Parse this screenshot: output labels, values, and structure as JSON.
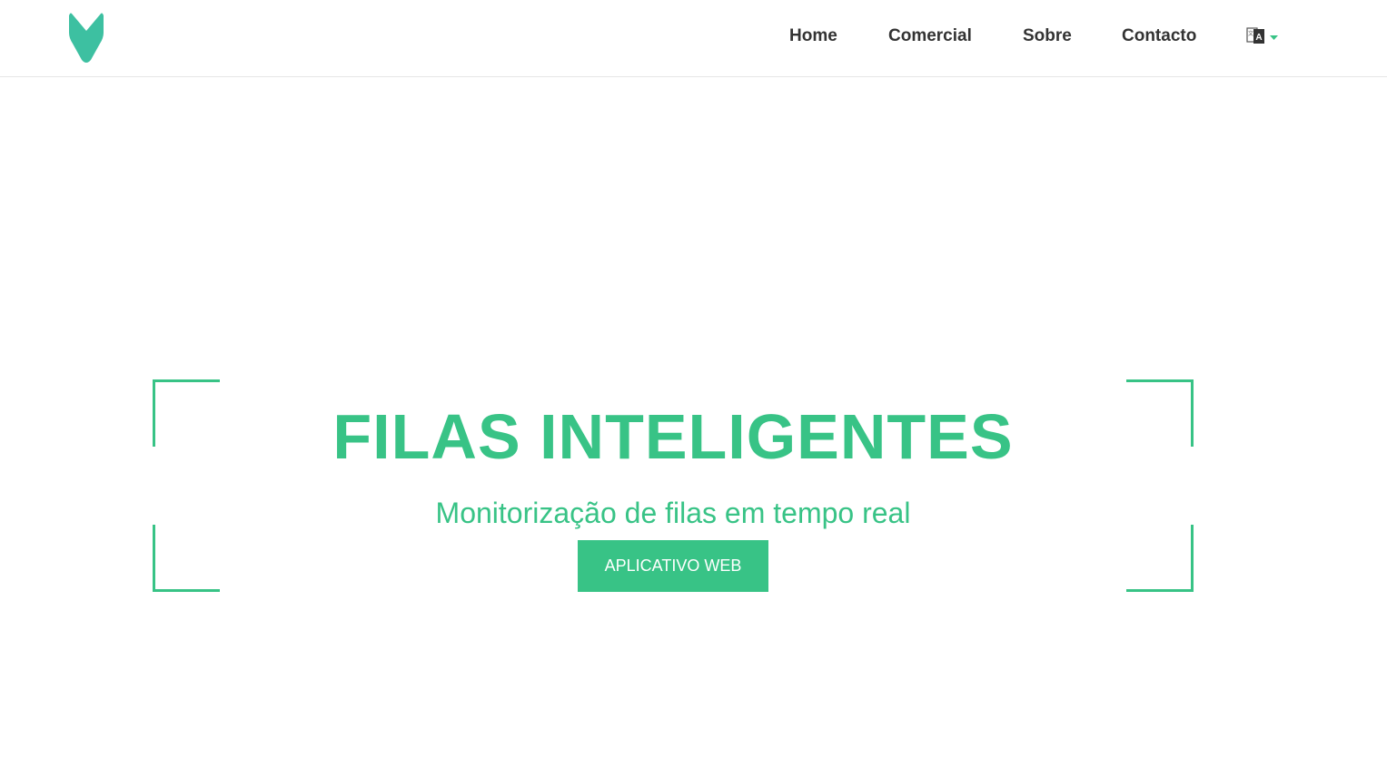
{
  "colors": {
    "accent": "#38c386",
    "logo": "#3dc0a1",
    "nav_text": "#333333",
    "background": "#ffffff"
  },
  "header": {
    "logo_icon": "brand-logo-icon",
    "nav": {
      "home": "Home",
      "comercial": "Comercial",
      "sobre": "Sobre",
      "contacto": "Contacto"
    },
    "language_icon": "translate-icon",
    "language_caret_icon": "caret-down-icon"
  },
  "hero": {
    "title": "FILAS INTELIGENTES",
    "subtitle": "Monitorização de filas em tempo real",
    "cta_label": "APLICATIVO WEB"
  }
}
